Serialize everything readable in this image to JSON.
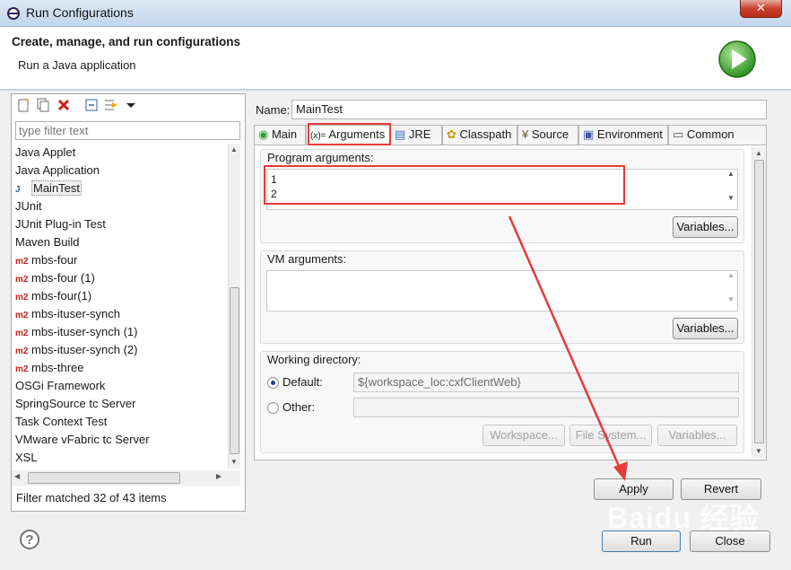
{
  "window": {
    "title": "Run Configurations",
    "close": "✕"
  },
  "header": {
    "title": "Create, manage, and run configurations",
    "subtitle": "Run a Java application"
  },
  "left": {
    "filter_placeholder": "type filter text",
    "items": [
      {
        "label": "Java Applet",
        "icon": ""
      },
      {
        "label": "Java Application",
        "icon": ""
      },
      {
        "label": "MainTest",
        "icon": "J"
      },
      {
        "label": "JUnit",
        "icon": ""
      },
      {
        "label": "JUnit Plug-in Test",
        "icon": ""
      },
      {
        "label": "Maven Build",
        "icon": ""
      },
      {
        "label": "mbs-four",
        "icon": "m2"
      },
      {
        "label": "mbs-four (1)",
        "icon": "m2"
      },
      {
        "label": "mbs-four(1)",
        "icon": "m2"
      },
      {
        "label": "mbs-ituser-synch",
        "icon": "m2"
      },
      {
        "label": "mbs-ituser-synch (1)",
        "icon": "m2"
      },
      {
        "label": "mbs-ituser-synch (2)",
        "icon": "m2"
      },
      {
        "label": "mbs-three",
        "icon": "m2"
      },
      {
        "label": "OSGi Framework",
        "icon": ""
      },
      {
        "label": "SpringSource tc Server",
        "icon": ""
      },
      {
        "label": "Task Context Test",
        "icon": ""
      },
      {
        "label": "VMware vFabric tc Server",
        "icon": ""
      },
      {
        "label": "XSL",
        "icon": ""
      }
    ],
    "status": "Filter matched 32 of 43 items"
  },
  "right": {
    "name_label": "Name:",
    "name_value": "MainTest",
    "tabs": [
      "Main",
      "Arguments",
      "JRE",
      "Classpath",
      "Source",
      "Environment",
      "Common"
    ],
    "program_args_label": "Program arguments:",
    "program_args_lines": [
      "1",
      "2"
    ],
    "variables_label": "Variables...",
    "vm_args_label": "VM arguments:",
    "working_dir_label": "Working directory:",
    "default_label": "Default:",
    "default_value": "${workspace_loc:cxfClientWeb}",
    "other_label": "Other:",
    "workspace_btn": "Workspace...",
    "filesystem_btn": "File System...",
    "variables_btn": "Variables..."
  },
  "buttons": {
    "apply": "Apply",
    "revert": "Revert",
    "run": "Run",
    "close": "Close"
  },
  "watermark": "Baidu 经验",
  "colors": {
    "annotation_red": "#e83a3a",
    "run_green": "#3aa52a"
  }
}
